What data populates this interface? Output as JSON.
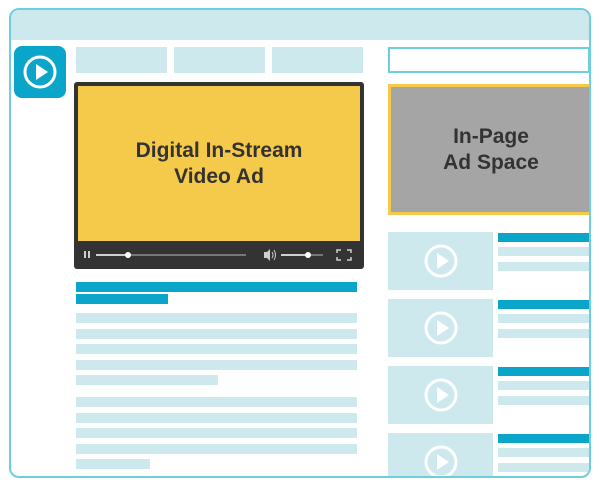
{
  "video_ad": {
    "line1": "Digital In-Stream",
    "line2": "Video Ad"
  },
  "inpage_ad": {
    "line1": "In-Page",
    "line2": "Ad Space"
  },
  "colors": {
    "accent": "#0aa5c9",
    "placeholder": "#cde9ee",
    "frame": "#6ecfdc",
    "video_ad": "#f5c94a",
    "inpage_ad": "#a5a5a5",
    "player": "#333333"
  },
  "icons": {
    "logo": "play-icon",
    "thumbnails": "play-icon",
    "player_controls": [
      "pause-icon",
      "volume-icon",
      "fullscreen-icon"
    ]
  }
}
